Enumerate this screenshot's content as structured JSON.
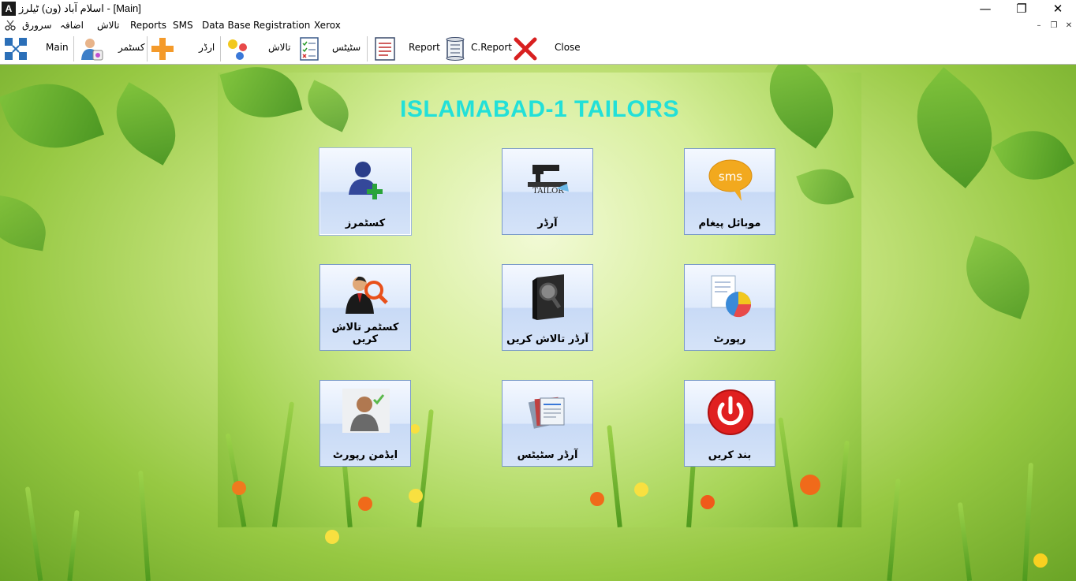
{
  "window": {
    "title": "اسلام آباد (ون) ٹیلرز - [Main]",
    "app_icon_glyph": "A",
    "minimize_glyph": "—",
    "restore_glyph": "❐",
    "close_glyph": "✕"
  },
  "menu": {
    "items": [
      {
        "label": "سرورق"
      },
      {
        "label": "اضافہ"
      },
      {
        "label": "تالاش"
      },
      {
        "label": "Reports"
      },
      {
        "label": "SMS"
      },
      {
        "label": "Data Base"
      },
      {
        "label": "Registration"
      },
      {
        "label": "Xerox"
      }
    ],
    "mdi_minimize": "–",
    "mdi_restore": "❐",
    "mdi_close": "✕"
  },
  "toolbar": {
    "main_label": "Main",
    "customer_label": "کسٹمر",
    "order_label": "ارڈر",
    "search_label": "تالاش",
    "status_label": "سٹیٹس",
    "report_label": "Report",
    "creport_label": "C.Report",
    "close_label": "Close"
  },
  "main": {
    "title": "ISLAMABAD-1 TAILORS",
    "tiles": [
      {
        "label": "کسٹمرز"
      },
      {
        "label": "آرڈر"
      },
      {
        "label": "موبائل پیغام"
      },
      {
        "label": "کسٹمر تالاش کریں"
      },
      {
        "label": "آرڈر تالاش کریں"
      },
      {
        "label": "رپورٹ"
      },
      {
        "label": "ایڈمن رپورٹ"
      },
      {
        "label": "آرڈر سٹیٹس"
      },
      {
        "label": "بند کریں"
      }
    ],
    "sms_icon_text": "sms",
    "tailor_icon_text": "TAILOR"
  },
  "colors": {
    "title_cyan": "#22e0d8",
    "tile_border": "#7a9ac8",
    "close_red": "#e02020"
  }
}
